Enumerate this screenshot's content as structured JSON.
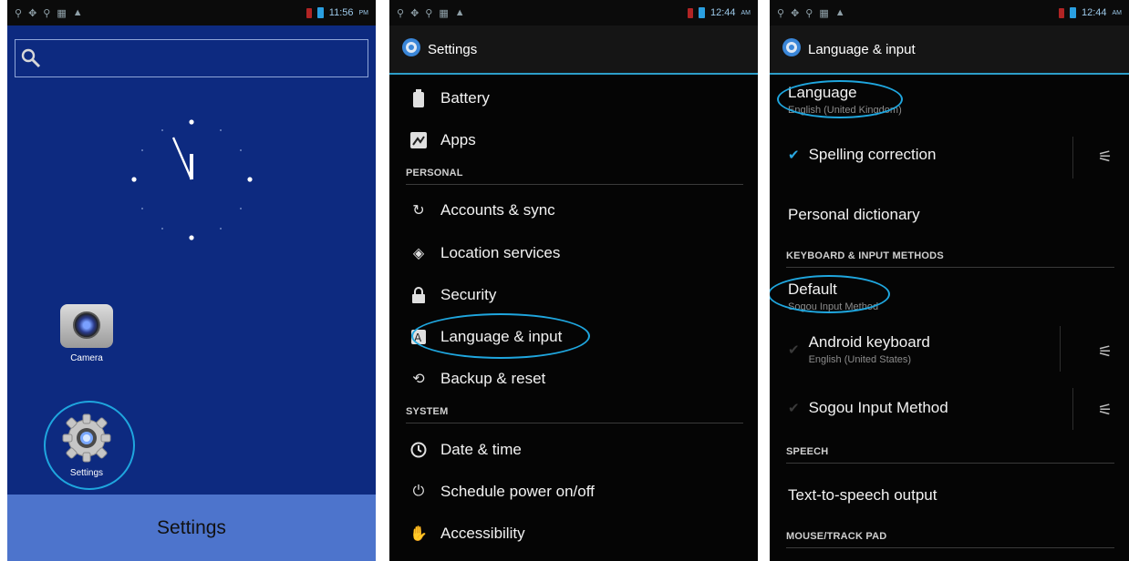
{
  "phone1": {
    "status_time": "11:56",
    "status_ampm": "PM",
    "apps": [
      {
        "label": "Camera"
      },
      {
        "label": "Settings"
      }
    ],
    "banner": "Settings"
  },
  "phone2": {
    "status_time": "12:44",
    "status_ampm": "AM",
    "title": "Settings",
    "items": [
      {
        "label": "Battery",
        "icon": "battery-icon"
      },
      {
        "label": "Apps",
        "icon": "apps-icon"
      },
      {
        "label": "Accounts & sync",
        "icon": "sync-icon"
      },
      {
        "label": "Location services",
        "icon": "location-icon"
      },
      {
        "label": "Security",
        "icon": "lock-icon"
      },
      {
        "label": "Language & input",
        "icon": "language-icon"
      },
      {
        "label": "Backup & reset",
        "icon": "backup-icon"
      },
      {
        "label": "Date & time",
        "icon": "clock-icon"
      },
      {
        "label": "Schedule power on/off",
        "icon": "power-schedule-icon"
      },
      {
        "label": "Accessibility",
        "icon": "hand-icon"
      }
    ],
    "sections": [
      "PERSONAL",
      "SYSTEM"
    ]
  },
  "phone3": {
    "status_time": "12:44",
    "status_ampm": "AM",
    "title": "Language & input",
    "language": {
      "title": "Language",
      "subtitle": "English (United Kingdom)"
    },
    "spelling": "Spelling correction",
    "personal_dictionary": "Personal dictionary",
    "sections": [
      "KEYBOARD & INPUT METHODS",
      "SPEECH",
      "MOUSE/TRACK PAD"
    ],
    "default": {
      "title": "Default",
      "subtitle": "Sogou Input Method"
    },
    "keyboards": [
      {
        "title": "Android keyboard",
        "subtitle": "English (United States)"
      },
      {
        "title": "Sogou Input Method",
        "subtitle": ""
      }
    ],
    "tts": "Text-to-speech output"
  },
  "colors": {
    "highlight": "#1fa6de",
    "launcher_bg": "#0d2a80",
    "banner": "#4d74cc",
    "settings_bg": "#050505"
  }
}
